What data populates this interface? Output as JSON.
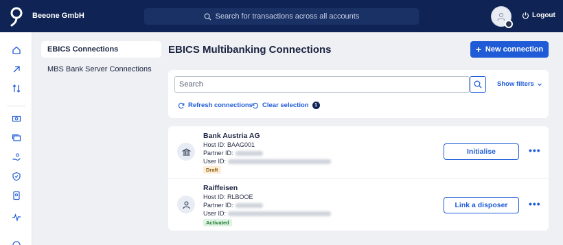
{
  "header": {
    "company": "Beeone GmbH",
    "search_placeholder": "Search for transactions across all accounts",
    "logout_label": "Logout"
  },
  "rail": {
    "icons": [
      "home-icon",
      "arrow-up-right-icon",
      "transfer-icon",
      "cash-icon",
      "cards-icon",
      "hand-coin-icon",
      "shield-icon",
      "document-icon",
      "activity-icon",
      "circle-icon"
    ]
  },
  "subnav": {
    "items": [
      {
        "label": "EBICS Connections",
        "active": true
      },
      {
        "label": "MBS Bank Server Connections",
        "active": false
      }
    ]
  },
  "page": {
    "title": "EBICS Multibanking Connections",
    "new_button": "New connection"
  },
  "filters": {
    "search_placeholder": "Search",
    "show_filters": "Show filters",
    "refresh": "Refresh connections",
    "clear_selection": "Clear selection",
    "selection_count": "1"
  },
  "connections": [
    {
      "name": "Bank Austria AG",
      "host_label": "Host ID:",
      "host_id": "BAAG001",
      "partner_label": "Partner ID:",
      "user_label": "User ID:",
      "status": "Draft",
      "action": "Initialise",
      "icon": "bank-icon"
    },
    {
      "name": "Raiffeisen",
      "host_label": "Host ID:",
      "host_id": "RLBOOE",
      "partner_label": "Partner ID:",
      "user_label": "User ID:",
      "status": "Activated",
      "action": "Link a disposer",
      "icon": "user-icon"
    }
  ],
  "colors": {
    "topbar": "#0f2454",
    "primary": "#1f5bd6",
    "draft": "#fdeed5",
    "activated": "#dff3e2"
  }
}
